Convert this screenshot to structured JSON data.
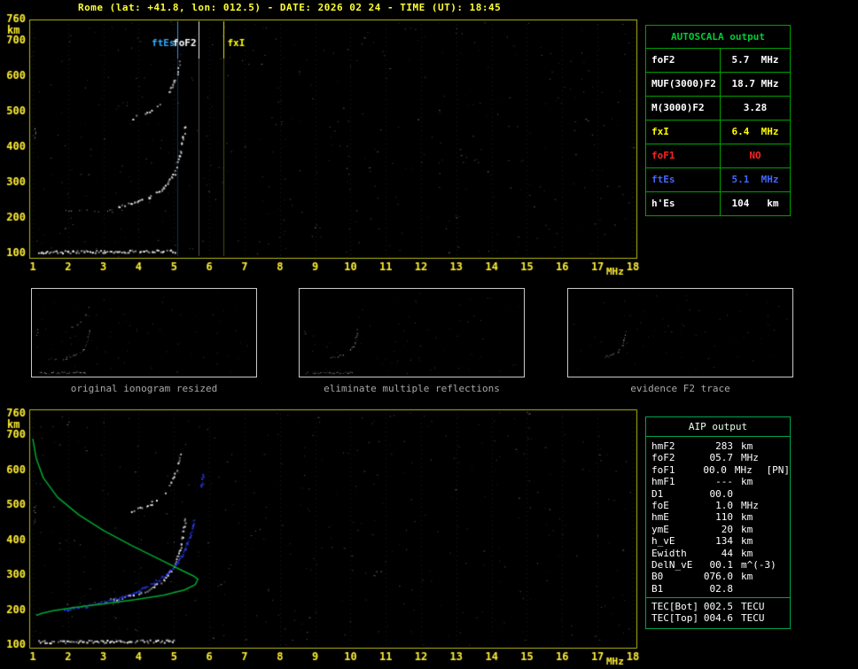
{
  "title": "Rome (lat: +41.8, lon: 012.5) - DATE: 2026 02 24 - TIME (UT): 18:45",
  "autoscala": {
    "header": "AUTOSCALA output",
    "rows": [
      {
        "label": "foF2",
        "value": "5.7  MHz",
        "color": "#ffffff"
      },
      {
        "label": "MUF(3000)F2",
        "value": "18.7 MHz",
        "color": "#ffffff"
      },
      {
        "label": "M(3000)F2",
        "value": "3.28",
        "color": "#ffffff"
      },
      {
        "label": "fxI",
        "value": "6.4  MHz",
        "color": "#ffff00"
      },
      {
        "label": "foF1",
        "value": "NO",
        "color": "#ff2222"
      },
      {
        "label": "ftEs",
        "value": "5.1  MHz",
        "color": "#4466ff"
      },
      {
        "label": "h'Es",
        "value": "104   km",
        "color": "#ffffff"
      }
    ]
  },
  "thumbnails": {
    "panels": [
      {
        "caption": "original ionogram resized",
        "traces": [
          0,
          1,
          2,
          3,
          4
        ]
      },
      {
        "caption": "eliminate multiple reflections",
        "traces": [
          0,
          2,
          4
        ]
      },
      {
        "caption": "evidence F2 trace",
        "traces": [
          2
        ]
      }
    ]
  },
  "aip": {
    "header": "AIP output",
    "rows": [
      {
        "name": "hmF2",
        "value": "283",
        "unit": "km",
        "extra": ""
      },
      {
        "name": "foF2",
        "value": "05.7",
        "unit": "MHz",
        "extra": ""
      },
      {
        "name": "foF1",
        "value": "00.0",
        "unit": "MHz",
        "extra": "[PN]"
      },
      {
        "name": "hmF1",
        "value": "---",
        "unit": "km",
        "extra": ""
      },
      {
        "name": "D1",
        "value": "00.0",
        "unit": "",
        "extra": ""
      },
      {
        "name": "foE",
        "value": "1.0",
        "unit": "MHz",
        "extra": ""
      },
      {
        "name": "hmE",
        "value": "110",
        "unit": "km",
        "extra": ""
      },
      {
        "name": "ymE",
        "value": "20",
        "unit": "km",
        "extra": ""
      },
      {
        "name": "h_vE",
        "value": "134",
        "unit": "km",
        "extra": ""
      },
      {
        "name": "Ewidth",
        "value": "44",
        "unit": "km",
        "extra": ""
      },
      {
        "name": "DelN_vE",
        "value": "00.1",
        "unit": "m^(-3)",
        "extra": ""
      },
      {
        "name": "B0",
        "value": "076.0",
        "unit": "km",
        "extra": ""
      },
      {
        "name": "B1",
        "value": "02.8",
        "unit": "",
        "extra": ""
      }
    ],
    "tec_rows": [
      {
        "name": "TEC[Bot]",
        "value": "002.5",
        "unit": "TECU",
        "extra": ""
      },
      {
        "name": "TEC[Top]",
        "value": "004.6",
        "unit": "TECU",
        "extra": ""
      }
    ]
  },
  "chart_data": [
    {
      "id": "ionogram-top",
      "type": "scatter",
      "title": "Ionogram with AUTOSCALA characteristic frequency markers",
      "xlabel": "MHz",
      "ylabel": "km",
      "xlim": [
        1,
        18
      ],
      "ylim": [
        100,
        760
      ],
      "xticks": [
        1,
        2,
        3,
        4,
        5,
        6,
        7,
        8,
        9,
        10,
        11,
        12,
        13,
        14,
        15,
        16,
        17,
        18
      ],
      "yticks": [
        100,
        200,
        300,
        400,
        500,
        600,
        700,
        760
      ],
      "grid": "faint dotted vertical lines at each integer MHz",
      "frame_color": "#b8b814",
      "tick_color": "#ffee33",
      "noise_color": "#c8c8c8",
      "markers": [
        {
          "label": "ftEs",
          "freq_mhz": 5.1,
          "color": "#33aaff"
        },
        {
          "label": "foF2",
          "freq_mhz": 5.7,
          "color": "#ffffff"
        },
        {
          "label": "fxI",
          "freq_mhz": 6.4,
          "color": "#ffff00"
        }
      ],
      "traces": [
        {
          "name": "Es layer echo ~105 km, 1.1-5.0 MHz",
          "color": "#ffffff",
          "size": 2,
          "density": 0.95,
          "points": [
            [
              1.15,
              103
            ],
            [
              3.0,
              104
            ],
            [
              5.0,
              105
            ]
          ]
        },
        {
          "name": "Es second reflection ~218 km",
          "color": "#dddddd",
          "size": 1,
          "density": 0.4,
          "points": [
            [
              1.95,
              218
            ],
            [
              3.5,
              218
            ]
          ]
        },
        {
          "name": "F2 trace",
          "color": "#ffffff",
          "size": 2,
          "density": 0.62,
          "points": [
            [
              3.2,
              228
            ],
            [
              3.8,
              240
            ],
            [
              4.3,
              258
            ],
            [
              4.7,
              285
            ],
            [
              5.0,
              325
            ],
            [
              5.15,
              370
            ],
            [
              5.25,
              425
            ],
            [
              5.3,
              462
            ]
          ]
        },
        {
          "name": "F2 second reflection",
          "color": "#eeeeee",
          "size": 2,
          "density": 0.45,
          "points": [
            [
              3.8,
              480
            ],
            [
              4.3,
              500
            ],
            [
              4.7,
              532
            ],
            [
              4.95,
              572
            ],
            [
              5.1,
              615
            ],
            [
              5.18,
              652
            ]
          ]
        },
        {
          "name": "low frequency edge streak",
          "color": "#cccccc",
          "size": 1,
          "density": 0.8,
          "points": [
            [
              1.04,
              418
            ],
            [
              1.07,
              458
            ]
          ]
        }
      ],
      "noise": {
        "seed": 11,
        "count": 430
      }
    },
    {
      "id": "ionogram-bottom",
      "type": "scatter",
      "title": "Ionogram with AIP restored trace and electron density profile",
      "xlabel": "MHz",
      "ylabel": "km",
      "xlim": [
        1,
        18
      ],
      "ylim": [
        100,
        760
      ],
      "xticks": [
        1,
        2,
        3,
        4,
        5,
        6,
        7,
        8,
        9,
        10,
        11,
        12,
        13,
        14,
        15,
        16,
        17,
        18
      ],
      "yticks": [
        100,
        200,
        300,
        400,
        500,
        600,
        700,
        760
      ],
      "grid": "faint dotted vertical lines at each integer MHz",
      "frame_color": "#b8b814",
      "tick_color": "#ffee33",
      "noise_color": "#c8c8c8",
      "traces": [
        {
          "name": "Es layer echo ~105 km",
          "color": "#ffffff",
          "size": 2,
          "density": 0.95,
          "points": [
            [
              1.15,
              108
            ],
            [
              3.0,
              109
            ],
            [
              5.0,
              110
            ]
          ]
        },
        {
          "name": "Es second reflection ~218 km",
          "color": "#dddddd",
          "size": 1,
          "density": 0.25,
          "points": [
            [
              1.95,
              218
            ],
            [
              3.5,
              218
            ]
          ]
        },
        {
          "name": "F2 trace",
          "color": "#ffffff",
          "size": 2,
          "density": 0.7,
          "points": [
            [
              3.2,
              228
            ],
            [
              3.8,
              240
            ],
            [
              4.3,
              258
            ],
            [
              4.7,
              285
            ],
            [
              5.0,
              325
            ],
            [
              5.15,
              370
            ],
            [
              5.25,
              425
            ],
            [
              5.3,
              462
            ]
          ]
        },
        {
          "name": "F2 second reflection",
          "color": "#eeeeee",
          "size": 2,
          "density": 0.45,
          "points": [
            [
              3.8,
              480
            ],
            [
              4.3,
              500
            ],
            [
              4.7,
              532
            ],
            [
              4.95,
              572
            ],
            [
              5.1,
              615
            ],
            [
              5.18,
              652
            ]
          ]
        },
        {
          "name": "restored F2 trace (AIP)",
          "color": "#2a3cff",
          "size": 2,
          "density": 1,
          "points": [
            [
              1.9,
              200
            ],
            [
              2.5,
              210
            ],
            [
              3.0,
              222
            ],
            [
              3.5,
              237
            ],
            [
              4.0,
              255
            ],
            [
              4.4,
              276
            ],
            [
              4.8,
              303
            ],
            [
              5.1,
              335
            ],
            [
              5.3,
              372
            ],
            [
              5.45,
              415
            ],
            [
              5.55,
              458
            ]
          ]
        },
        {
          "name": "restored trace upper segment",
          "color": "#2a3cff",
          "size": 2,
          "density": 0.8,
          "points": [
            [
              5.75,
              552
            ],
            [
              5.8,
              585
            ]
          ]
        },
        {
          "name": "low frequency edge streak",
          "color": "#cccccc",
          "size": 1,
          "density": 0.6,
          "points": [
            [
              1.03,
              445
            ],
            [
              1.06,
              500
            ]
          ]
        }
      ],
      "profile": {
        "name": "electron density profile N(h)",
        "color": "#00a830",
        "points": [
          [
            1.0,
            687
          ],
          [
            1.1,
            630
          ],
          [
            1.3,
            575
          ],
          [
            1.7,
            520
          ],
          [
            2.3,
            470
          ],
          [
            3.0,
            425
          ],
          [
            3.8,
            382
          ],
          [
            4.6,
            342
          ],
          [
            5.2,
            312
          ],
          [
            5.55,
            295
          ],
          [
            5.68,
            286
          ],
          [
            5.6,
            270
          ],
          [
            5.3,
            255
          ],
          [
            4.7,
            240
          ],
          [
            3.9,
            227
          ],
          [
            3.0,
            215
          ],
          [
            2.2,
            205
          ],
          [
            1.6,
            196
          ],
          [
            1.25,
            188
          ],
          [
            1.1,
            182
          ]
        ]
      },
      "noise": {
        "seed": 23,
        "count": 380
      }
    }
  ]
}
